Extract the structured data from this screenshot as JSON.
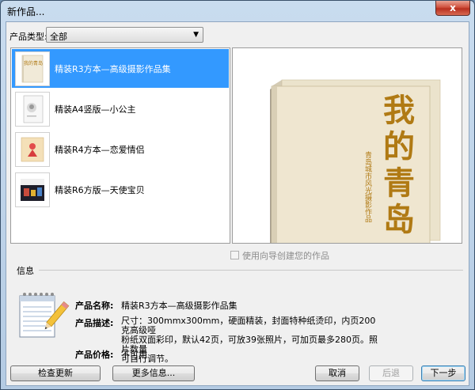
{
  "window": {
    "title": "新作品...",
    "close_glyph": "x"
  },
  "product_type": {
    "label": "产品类型:",
    "selected": "全部"
  },
  "products": [
    {
      "name": "精装R3方本—高级摄影作品集",
      "selected": true,
      "cover_text": "我的青岛"
    },
    {
      "name": "精装A4竖版—小公主",
      "selected": false
    },
    {
      "name": "精装R4方本—恋爱情侣",
      "selected": false
    },
    {
      "name": "精装R6方版—天使宝贝",
      "selected": false
    }
  ],
  "preview": {
    "title_chars": [
      "我",
      "的",
      "青",
      "岛"
    ],
    "subtitle": "青岛城市风光摄影作品",
    "colors": {
      "title": "#b07a14",
      "cover": "#efe6d0",
      "spine": "#d9cfb6"
    }
  },
  "wizard_checkbox": {
    "label": "使用向导创建您的作品",
    "checked": false,
    "enabled": false
  },
  "info": {
    "legend": "信息",
    "name_label": "产品名称:",
    "name_value": "精装R3方本—高级摄影作品集",
    "desc_label": "产品描述:",
    "desc_lines": [
      "尺寸：300mmx300mm，硬面精装，封面特种纸烫印，内页200克高级哑",
      "粉纸双面彩印，默认42页，可放39张照片，可加页最多280页。照片数量",
      "可自行调节。"
    ],
    "price_label": "产品价格:",
    "price_value": "不可用"
  },
  "buttons": {
    "check_update": "检查更新",
    "more_info": "更多信息...",
    "cancel": "取消",
    "back": "后退",
    "next": "下一步"
  }
}
